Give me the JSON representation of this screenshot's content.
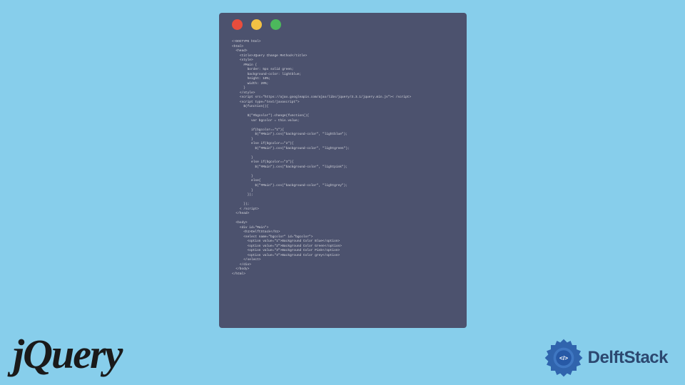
{
  "window": {
    "dots": {
      "red": "#E84D3D",
      "yellow": "#F3C244",
      "green": "#4CB85C"
    },
    "code": "<!DOCTYPE html>\n<html>\n  <head>\n    <title>JQuery Change Method</title>\n    <style>\n      #Main {\n        border: 5px solid green;\n        background-color: lightblue;\n        height: 10%;\n        width: 20%;\n      }\n    </style>\n    <script src=\"https://ajax.googleapis.com/ajax/libs/jquery/3.3.1/jquery.min.js\">< /script>\n    <script type=\"text/javascript\">\n      $(function(){\n\n        $(\"#bgcolor\").change(function(){\n          var bgcolor = this.value;\n\n          if(bgcolor==\"1\"){\n            $(\"#Main\").css(\"background-color\", \"lightblue\");\n          }\n          else if(bgcolor==\"2\"){\n            $(\"#Main\").css(\"background-color\", \"lightgreen\");\n\n          }\n          else if(bgcolor==\"3\"){\n            $(\"#Main\").css(\"background-color\", \"lightpink\");\n\n          }\n          else{\n            $(\"#Main\").css(\"background-color\", \"lightgrey\");\n          }\n        });\n\n      });\n    < /script>\n  </head>\n\n  <body>\n    <div id=\"Main\">\n      <h1>DelftStack</h1>\n      <select name=\"bgcolor\" id=\"bgcolor\">\n        <option value=\"1\">Background Color Blue</option>\n        <option value=\"2\">Background Color Green</option>\n        <option value=\"3\">Background Color Pink</option>\n        <option value=\"4\">Background Color grey</option>\n      </select>\n    </div>\n  </body>\n</html>"
  },
  "logos": {
    "jquery_text": "jQuery",
    "delft_text": "DelftStack",
    "delft_code_glyph": "</>"
  }
}
